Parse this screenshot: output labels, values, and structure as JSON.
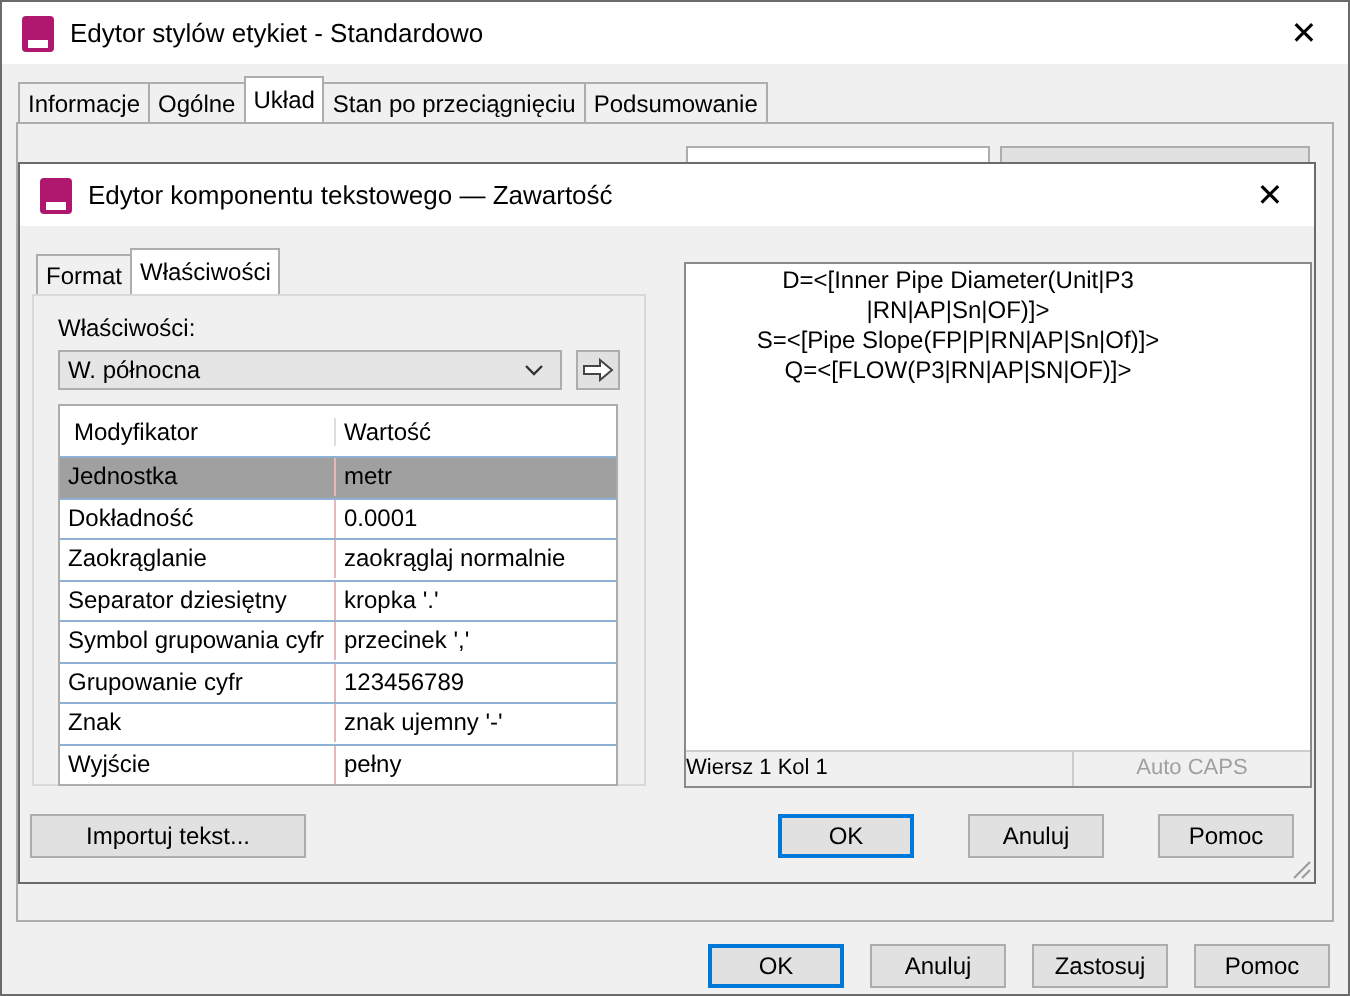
{
  "window": {
    "title": "Edytor stylów etykiet - Standardowo",
    "close": "✕"
  },
  "tabs": [
    {
      "label": "Informacje",
      "selected": false
    },
    {
      "label": "Ogólne",
      "selected": false
    },
    {
      "label": "Układ",
      "selected": true
    },
    {
      "label": "Stan po przeciągnięciu",
      "selected": false
    },
    {
      "label": "Podsumowanie",
      "selected": false
    }
  ],
  "dialog": {
    "title": "Edytor komponentu tekstowego — Zawartość",
    "close": "✕",
    "tabs": [
      {
        "label": "Format",
        "selected": false
      },
      {
        "label": "Właściwości",
        "selected": true
      }
    ],
    "properties_label": "Właściwości:",
    "properties_value": "W. północna",
    "table": {
      "columns": [
        "Modyfikator",
        "Wartość"
      ],
      "rows": [
        {
          "cells": [
            "Jednostka",
            "metr"
          ],
          "selected": true
        },
        {
          "cells": [
            "Dokładność",
            "0.0001"
          ],
          "selected": false
        },
        {
          "cells": [
            "Zaokrąglanie",
            "zaokrąglaj normalnie"
          ],
          "selected": false
        },
        {
          "cells": [
            "Separator dziesiętny",
            "kropka '.'"
          ],
          "selected": false
        },
        {
          "cells": [
            "Symbol grupowania cyfr",
            "przecinek ','"
          ],
          "selected": false
        },
        {
          "cells": [
            "Grupowanie cyfr",
            "123456789"
          ],
          "selected": false
        },
        {
          "cells": [
            "Znak",
            "znak ujemny '-'"
          ],
          "selected": false
        },
        {
          "cells": [
            "Wyjście",
            "pełny"
          ],
          "selected": false
        }
      ]
    },
    "editor_lines": [
      "D=<[Inner Pipe Diameter(Unit|P3",
      "|RN|AP|Sn|OF)]>",
      "S=<[Pipe Slope(FP|P|RN|AP|Sn|Of)]>",
      "Q=<[FLOW(P3|RN|AP|SN|OF)]>"
    ],
    "status": {
      "position": "Wiersz 1 Kol 1",
      "caps": "Auto CAPS",
      "caps_disabled": true
    },
    "import_button": "Importuj tekst...",
    "buttons": [
      {
        "label": "OK",
        "default": true
      },
      {
        "label": "Anuluj",
        "default": false
      },
      {
        "label": "Pomoc",
        "default": false
      }
    ]
  },
  "buttons": [
    {
      "label": "OK",
      "default": true
    },
    {
      "label": "Anuluj",
      "default": false
    },
    {
      "label": "Zastosuj",
      "default": false
    },
    {
      "label": "Pomoc",
      "default": false
    }
  ]
}
